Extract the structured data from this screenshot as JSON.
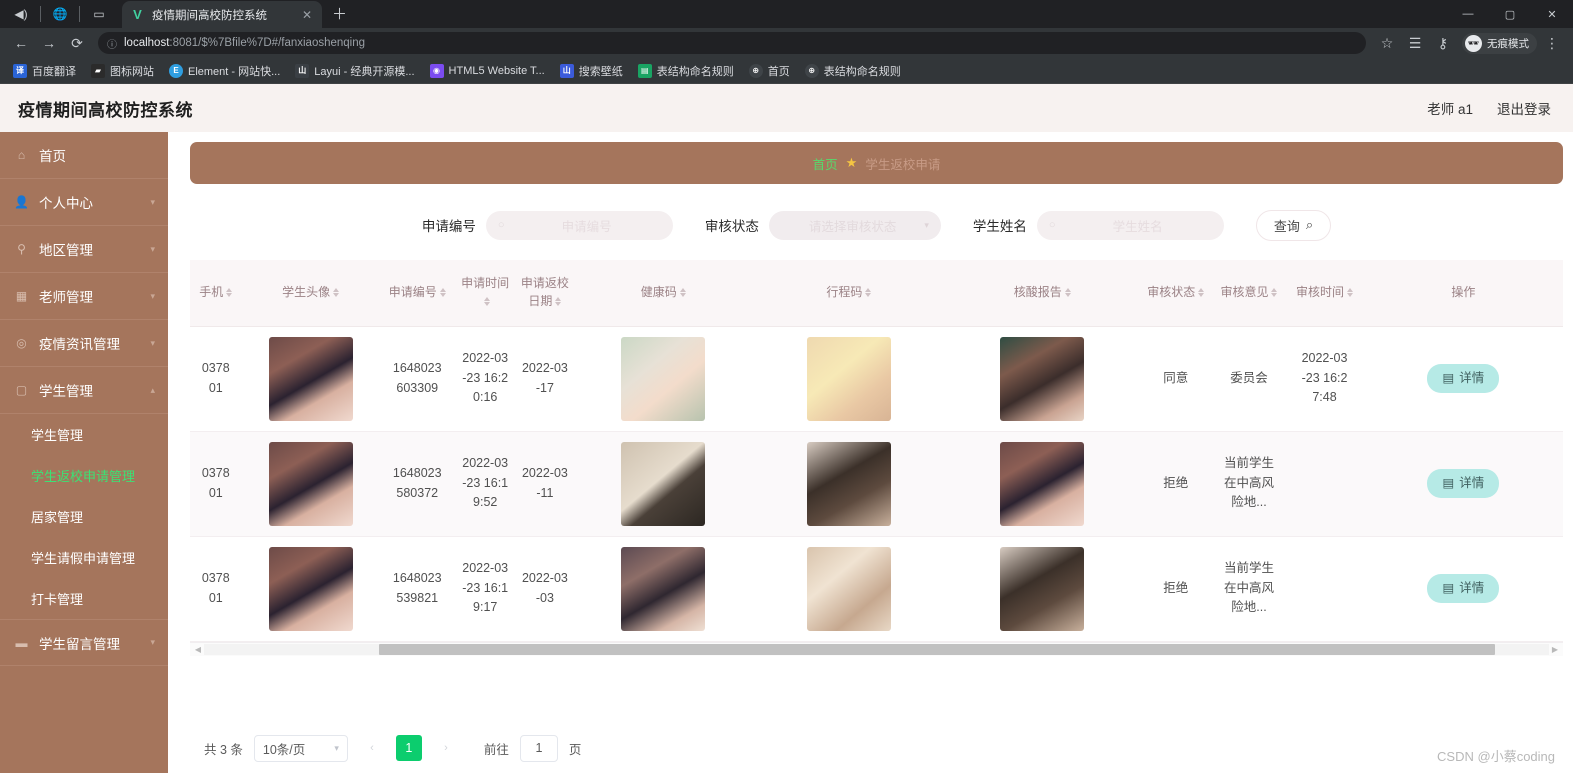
{
  "browser": {
    "tab": {
      "title": "疫情期间高校防控系统",
      "favicon": "V",
      "close_icon": "close-icon"
    },
    "newtab_icon": "plus-icon",
    "window_controls": [
      "minimize",
      "maximize",
      "close"
    ],
    "nav": {
      "back_icon": "back-arrow-icon",
      "forward_icon": "forward-arrow-icon",
      "reload_icon": "reload-icon"
    },
    "omnibox": {
      "info_icon": "info-circle-icon",
      "host": "localhost",
      "rest": ":8081/$%7Bfile%7D#/fanxiaoshenqing"
    },
    "toolbar_right": {
      "star_icon": "star-icon",
      "list_icon": "reading-list-icon",
      "key_icon": "key-icon",
      "incognito_label": "无痕模式"
    },
    "bookmarks": [
      {
        "label": "百度翻译",
        "icon": "translate-icon",
        "color": "#2a64d6",
        "glyph": "译"
      },
      {
        "label": "图标网站",
        "icon": "flag-icon",
        "color": "#2b2b2b",
        "glyph": "▰"
      },
      {
        "label": "Element - 网站快...",
        "icon": "element-icon",
        "color": "#2f9ee0",
        "glyph": "E"
      },
      {
        "label": "Layui - 经典开源模...",
        "icon": "layui-icon",
        "color": "#3a3f44",
        "glyph": "山"
      },
      {
        "label": "HTML5 Website T...",
        "icon": "html5-icon",
        "color": "#7b4cf0",
        "glyph": "◉"
      },
      {
        "label": "搜索壁纸",
        "icon": "wallpaper-icon",
        "color": "#3b5bdb",
        "glyph": "山"
      },
      {
        "label": "表结构命名规则",
        "icon": "sheet-icon",
        "color": "#19a463",
        "glyph": "▤"
      },
      {
        "label": "首页",
        "icon": "globe-icon",
        "color": "#3f4448",
        "glyph": "🌐"
      },
      {
        "label": "表结构命名规则",
        "icon": "globe-icon",
        "color": "#3f4448",
        "glyph": "🌐"
      }
    ]
  },
  "app": {
    "title": "疫情期间高校防控系统",
    "user": "老师 a1",
    "logout": "退出登录"
  },
  "breadcrumb": {
    "home": "首页",
    "star_icon": "star-icon",
    "current": "学生返校申请"
  },
  "filters": {
    "apply_no": {
      "label": "申请编号",
      "placeholder": "申请编号",
      "value": "",
      "icon": "search-icon"
    },
    "status": {
      "label": "审核状态",
      "placeholder": "请选择审核状态",
      "value": "",
      "icon": "chevron-down-icon"
    },
    "student_name": {
      "label": "学生姓名",
      "placeholder": "学生姓名",
      "value": "",
      "icon": "search-icon"
    },
    "query_button": {
      "label": "查询",
      "icon": "search-icon"
    }
  },
  "table": {
    "columns": [
      {
        "label": "手机",
        "sortable": true
      },
      {
        "label": "学生头像",
        "sortable": true
      },
      {
        "label": "申请编号",
        "sortable": true
      },
      {
        "label": "申请时间",
        "sortable": true
      },
      {
        "label": "申请返校日期",
        "sortable": true
      },
      {
        "label": "健康码",
        "sortable": true
      },
      {
        "label": "行程码",
        "sortable": true
      },
      {
        "label": "核酸报告",
        "sortable": true
      },
      {
        "label": "审核状态",
        "sortable": true
      },
      {
        "label": "审核意见",
        "sortable": true
      },
      {
        "label": "审核时间",
        "sortable": true
      },
      {
        "label": "操作",
        "sortable": false
      }
    ],
    "rows": [
      {
        "phone": "0378\n01",
        "avatar": "student-avatar",
        "apply_no": "1648023\n603309",
        "apply_time": "2022-03\n-23 16:2\n0:16",
        "return_date": "2022-03\n-17",
        "health_code": "health-code-image",
        "travel_code": "travel-code-image",
        "nucleic_report": "nucleic-report-image",
        "status": "同意",
        "opinion": "委员会",
        "review_time": "2022-03\n-23 16:2\n7:48",
        "action": "详情"
      },
      {
        "phone": "0378\n01",
        "avatar": "student-avatar",
        "apply_no": "1648023\n580372",
        "apply_time": "2022-03\n-23 16:1\n9:52",
        "return_date": "2022-03\n-11",
        "health_code": "health-code-image",
        "travel_code": "travel-code-image",
        "nucleic_report": "nucleic-report-image",
        "status": "拒绝",
        "opinion": "当前学生\n在中高风\n险地...",
        "review_time": "",
        "action": "详情"
      },
      {
        "phone": "0378\n01",
        "avatar": "student-avatar",
        "apply_no": "1648023\n539821",
        "apply_time": "2022-03\n-23 16:1\n9:17",
        "return_date": "2022-03\n-03",
        "health_code": "health-code-image",
        "travel_code": "travel-code-image",
        "nucleic_report": "nucleic-report-image",
        "status": "拒绝",
        "opinion": "当前学生\n在中高风\n险地...",
        "review_time": "",
        "action": "详情"
      }
    ]
  },
  "pagination": {
    "total": "共 3 条",
    "page_size": "10条/页",
    "prev_icon": "chevron-left-icon",
    "current_page": "1",
    "next_icon": "chevron-right-icon",
    "goto_label": "前往",
    "goto_value": "1",
    "page_unit": "页"
  },
  "sidebar": {
    "items": [
      {
        "label": "首页",
        "icon": "home-icon",
        "has_arrow": false
      },
      {
        "label": "个人中心",
        "icon": "user-icon",
        "has_arrow": true
      },
      {
        "label": "地区管理",
        "icon": "location-icon",
        "has_arrow": true
      },
      {
        "label": "老师管理",
        "icon": "teacher-icon",
        "has_arrow": true
      },
      {
        "label": "疫情资讯管理",
        "icon": "news-icon",
        "has_arrow": true
      },
      {
        "label": "学生管理",
        "icon": "student-icon",
        "has_arrow": true
      },
      {
        "label": "学生留言管理",
        "icon": "message-icon",
        "has_arrow": true
      }
    ],
    "sub_items": [
      {
        "label": "学生管理",
        "active": false
      },
      {
        "label": "学生返校申请管理",
        "active": true
      },
      {
        "label": "居家管理",
        "active": false
      },
      {
        "label": "学生请假申请管理",
        "active": false
      },
      {
        "label": "打卡管理",
        "active": false
      }
    ]
  },
  "watermark": "CSDN @小蔡coding",
  "colors": {
    "sidebar_brown": "#a5755c",
    "banner_brown": "#a5755c",
    "active_green": "#3ae374",
    "pager_green": "#0ccd6e",
    "detail_teal": "#b6eae6"
  }
}
